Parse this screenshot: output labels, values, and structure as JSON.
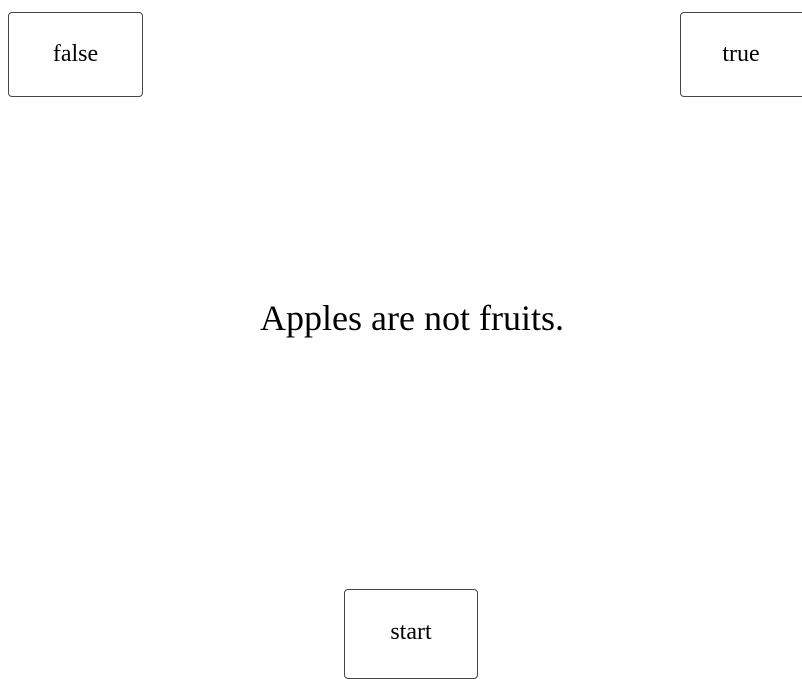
{
  "buttons": {
    "false_label": "false",
    "true_label": "true",
    "start_label": "start"
  },
  "statement": "Apples are not fruits."
}
